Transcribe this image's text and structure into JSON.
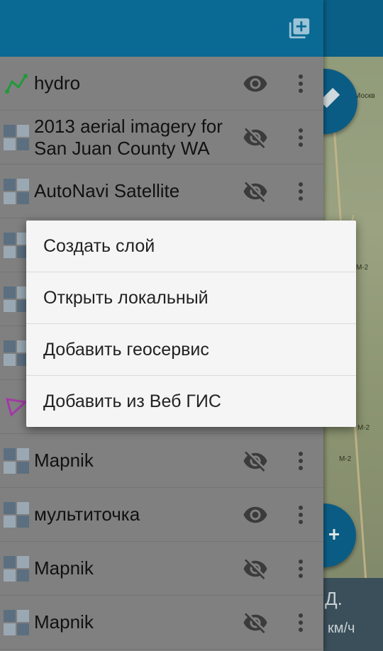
{
  "header": {
    "add_icon": "library-add-icon"
  },
  "layers": [
    {
      "name": "hydro",
      "type": "line",
      "visible": true
    },
    {
      "name": "2013 aerial imagery for San Juan County WA",
      "type": "raster",
      "visible": false
    },
    {
      "name": "AutoNavi Satellite",
      "type": "raster",
      "visible": false
    },
    {
      "name": "",
      "type": "raster",
      "visible": false
    },
    {
      "name": "",
      "type": "raster",
      "visible": false
    },
    {
      "name": "",
      "type": "raster",
      "visible": false
    },
    {
      "name": "",
      "type": "polygon",
      "visible": false
    },
    {
      "name": "Mapnik",
      "type": "raster",
      "visible": false
    },
    {
      "name": "мультиточка",
      "type": "raster",
      "visible": true
    },
    {
      "name": "Mapnik",
      "type": "raster",
      "visible": false
    },
    {
      "name": "Mapnik",
      "type": "raster",
      "visible": false
    }
  ],
  "popup_menu": {
    "items": [
      "Создать слой",
      "Открыть локальный",
      "Добавить геосервис",
      "Добавить из Веб ГИС"
    ]
  },
  "map": {
    "label_city": "Москв",
    "road_labels": [
      "M-2",
      "M-2",
      "M-2"
    ],
    "speed_value": "Д.",
    "speed_unit": "км/ч"
  },
  "colors": {
    "header": "#0a6a94",
    "drawer": "#808080",
    "popup": "#f5f5f5",
    "line_icon": "#1f9a3a",
    "polygon_icon": "#a23aa8"
  }
}
